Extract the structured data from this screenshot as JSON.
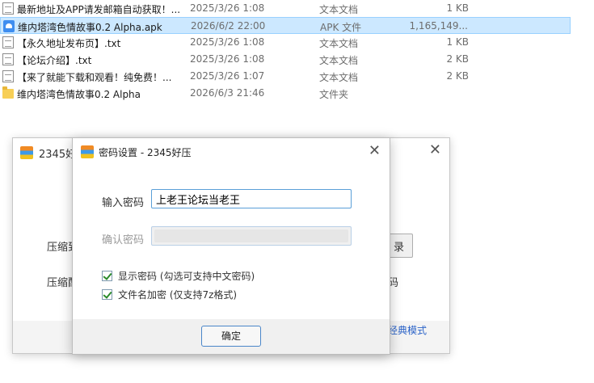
{
  "files": [
    {
      "name": "最新地址及APP请发邮箱自动获取！...",
      "date": "2025/3/26 1:08",
      "type": "文本文档",
      "size": "1 KB",
      "icon": "text-file-icon"
    },
    {
      "name": "维内塔湾色情故事0.2 Alpha.apk",
      "date": "2026/6/2 22:00",
      "type": "APK 文件",
      "size": "1,165,149...",
      "icon": "apk-file-icon",
      "selected": true
    },
    {
      "name": "【永久地址发布页】.txt",
      "date": "2025/3/26 1:08",
      "type": "文本文档",
      "size": "1 KB",
      "icon": "text-file-icon"
    },
    {
      "name": "【论坛介绍】.txt",
      "date": "2025/3/26 1:08",
      "type": "文本文档",
      "size": "2 KB",
      "icon": "text-file-icon"
    },
    {
      "name": "【来了就能下载和观看！纯免费！...",
      "date": "2025/3/26 1:07",
      "type": "文本文档",
      "size": "2 KB",
      "icon": "text-file-icon"
    },
    {
      "name": "维内塔湾色情故事0.2 Alpha",
      "date": "2026/6/3 21:46",
      "type": "文件夹",
      "size": "",
      "icon": "folder-icon"
    }
  ],
  "back_window": {
    "title": "2345好",
    "label1": "压缩到",
    "label2": "压缩配",
    "browse_button": "录",
    "fragment2": "码",
    "classic_link": "经典模式"
  },
  "password_dialog": {
    "title": "密码设置 - 2345好压",
    "password_label": "输入密码",
    "password_value": "上老王论坛当老王",
    "confirm_label": "确认密码",
    "confirm_value": "",
    "show_password_label": "显示密码 (勾选可支持中文密码)",
    "show_password_checked": true,
    "encrypt_names_label": "文件名加密  (仅支持7z格式)",
    "encrypt_names_checked": true,
    "ok_button": "确定"
  },
  "colors": {
    "selection": "#cce8ff",
    "accent_blue": "#2b63c8",
    "check_green": "#2a8a2a"
  }
}
